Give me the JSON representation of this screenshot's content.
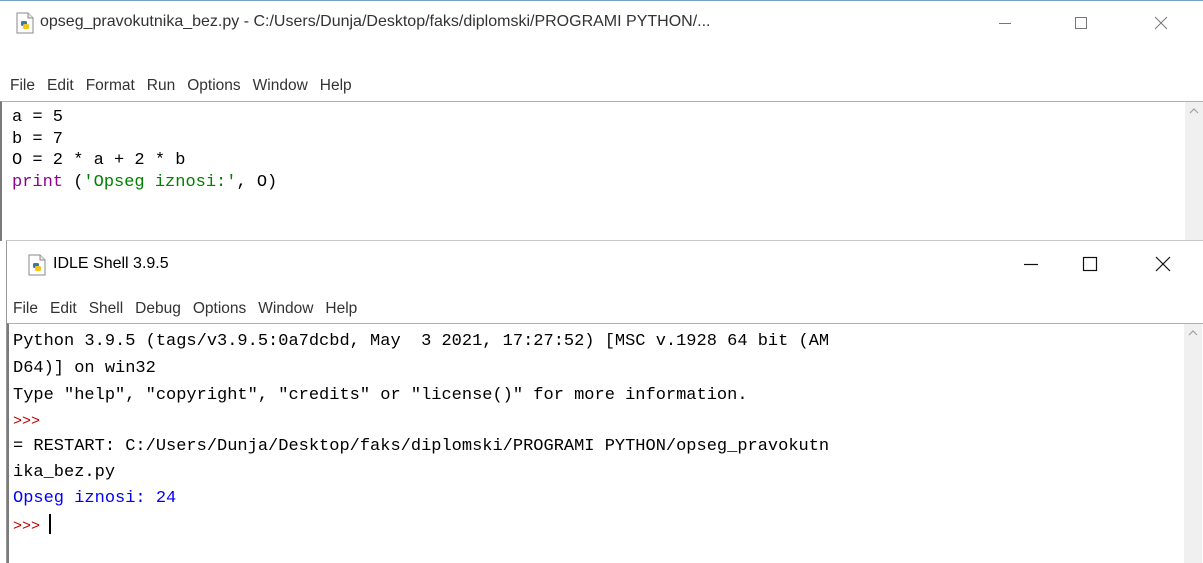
{
  "editor": {
    "title": "opseg_pravokutnika_bez.py - C:/Users/Dunja/Desktop/faks/diplomski/PROGRAMI PYTHON/...",
    "menu": [
      "File",
      "Edit",
      "Format",
      "Run",
      "Options",
      "Window",
      "Help"
    ],
    "code": {
      "line1": "a = 5",
      "line2": "b = 7",
      "line3": "O = 2 * a + 2 * b",
      "line4_func": "print",
      "line4_open": " (",
      "line4_str": "'Opseg iznosi:'",
      "line4_rest": ", O)"
    }
  },
  "shell": {
    "title": "IDLE Shell 3.9.5",
    "menu": [
      "File",
      "Edit",
      "Shell",
      "Debug",
      "Options",
      "Window",
      "Help"
    ],
    "lines": {
      "l1": "Python 3.9.5 (tags/v3.9.5:0a7dcbd, May  3 2021, 17:27:52) [MSC v.1928 64 bit (AM",
      "l2": "D64)] on win32",
      "l3": "Type \"help\", \"copyright\", \"credits\" or \"license()\" for more information.",
      "p1": ">>>",
      "l5": "= RESTART: C:/Users/Dunja/Desktop/faks/diplomski/PROGRAMI PYTHON/opseg_pravokutn",
      "l6": "ika_bez.py",
      "out": "Opseg iznosi: 24",
      "p2": ">>>"
    }
  },
  "colors": {
    "keyword": "#900090",
    "string": "#008000",
    "prompt": "#c00000",
    "output": "#0000ff"
  },
  "icons": [
    "python-file-icon",
    "minimize-icon",
    "maximize-icon",
    "close-icon",
    "scroll-up-icon"
  ]
}
